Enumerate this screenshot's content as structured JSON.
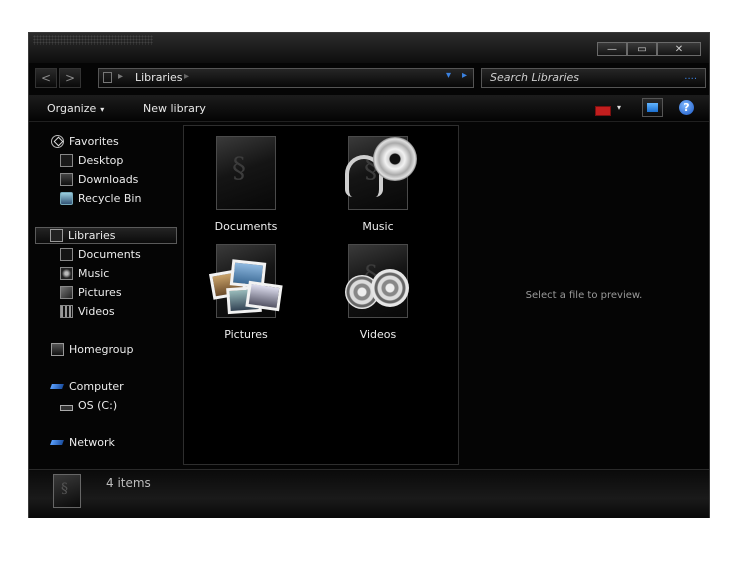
{
  "titlebar": {
    "minimize_label": "—",
    "maximize_label": "▭",
    "close_label": "✕"
  },
  "navigation": {
    "back_label": "<",
    "forward_label": ">"
  },
  "address_bar": {
    "crumb": "Libraries",
    "separator": "▸",
    "dropdown_glyph": "▾",
    "go_glyph": "▸"
  },
  "search": {
    "placeholder": "Search Libraries",
    "icon_glyph": "...."
  },
  "toolbar": {
    "organize_label": "Organize",
    "new_library_label": "New library",
    "caret": "▾",
    "help_label": "?"
  },
  "nav_pane": {
    "favorites": "Favorites",
    "desktop": "Desktop",
    "downloads": "Downloads",
    "recycle_bin": "Recycle Bin",
    "libraries": "Libraries",
    "documents": "Documents",
    "music": "Music",
    "pictures": "Pictures",
    "videos": "Videos",
    "homegroup": "Homegroup",
    "computer": "Computer",
    "os_drive": "OS (C:)",
    "network": "Network"
  },
  "content": {
    "items": [
      {
        "label": "Documents"
      },
      {
        "label": "Music"
      },
      {
        "label": "Pictures"
      },
      {
        "label": "Videos"
      }
    ]
  },
  "preview": {
    "message": "Select a file to preview."
  },
  "status": {
    "count_text": "4 items"
  },
  "colors": {
    "accent_blue": "#3b82e0",
    "flag_red": "#c21e1e",
    "window_bg": "#050505"
  }
}
